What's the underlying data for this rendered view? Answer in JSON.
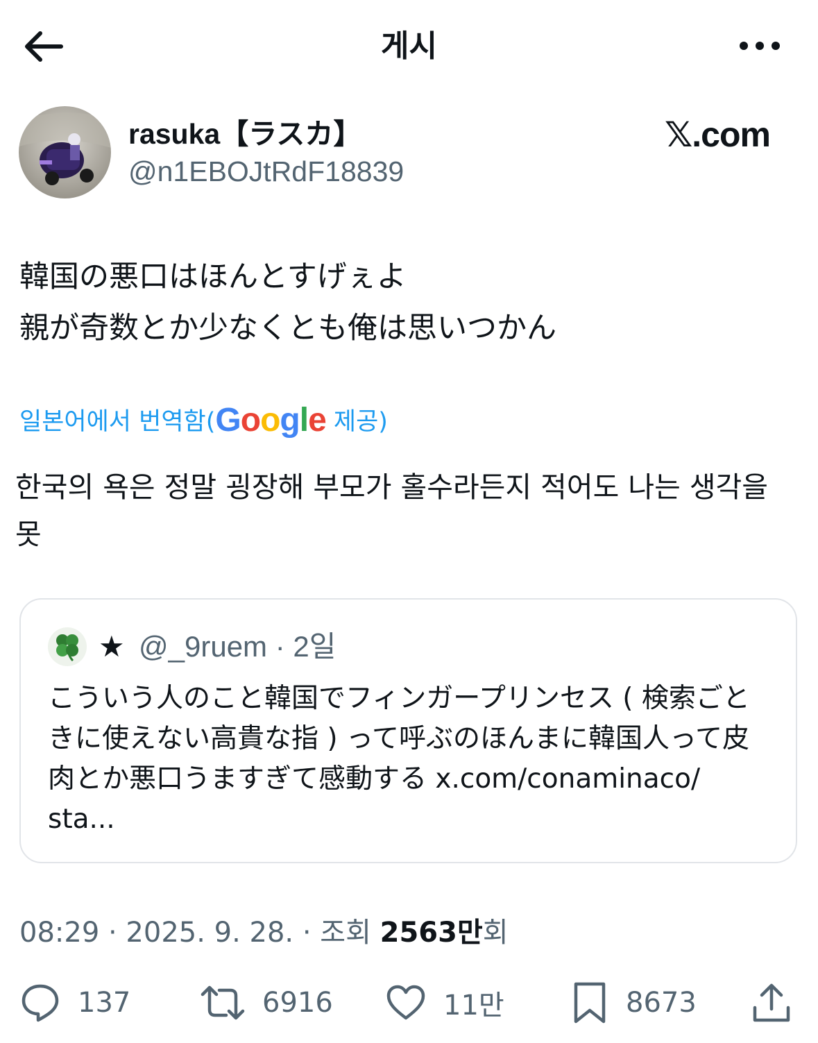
{
  "header": {
    "title": "게시",
    "back_icon": "arrow-left-icon",
    "more_icon": "more-dots-icon"
  },
  "author": {
    "display_name": "rasuka【ラスカ】",
    "handle": "@n1EBOJtRdF18839",
    "watermark": "𝕏.com"
  },
  "tweet": {
    "lines": [
      "韓国の悪口はほんとすげぇよ",
      "親が奇数とか少なくとも俺は思いつかん"
    ],
    "translation_label": "일본어에서 번역함(",
    "translation_provider": "Google",
    "translation_suffix": " 제공)",
    "translated_text": "한국의 욕은 정말 굉장해 부모가 홀수라든지 적어도 나는 생각을 못"
  },
  "quote": {
    "name_icon": "star-icon",
    "star": "★",
    "handle": "@_9ruem",
    "separator": " · ",
    "time": "2일",
    "lines": [
      "こういう人のこと韓国でフィンガープリンセス ( 検索ごと",
      "きに使えない高貴な指 ) って呼ぶのほんまに韓国人って皮",
      "肉とか悪口うますぎて感動する x.com/conaminaco/",
      "sta..."
    ]
  },
  "meta": {
    "time_date": "08:29 · 2025. 9. 28. · 조회 ",
    "views": "2563만",
    "views_suffix": "회"
  },
  "actions": {
    "replies": "137",
    "reposts": "6916",
    "likes": "11만",
    "bookmarks": "8673"
  },
  "colors": {
    "link": "#1d9bf0",
    "secondary": "#536471",
    "text": "#0f1419",
    "border": "#e1e4e8"
  }
}
